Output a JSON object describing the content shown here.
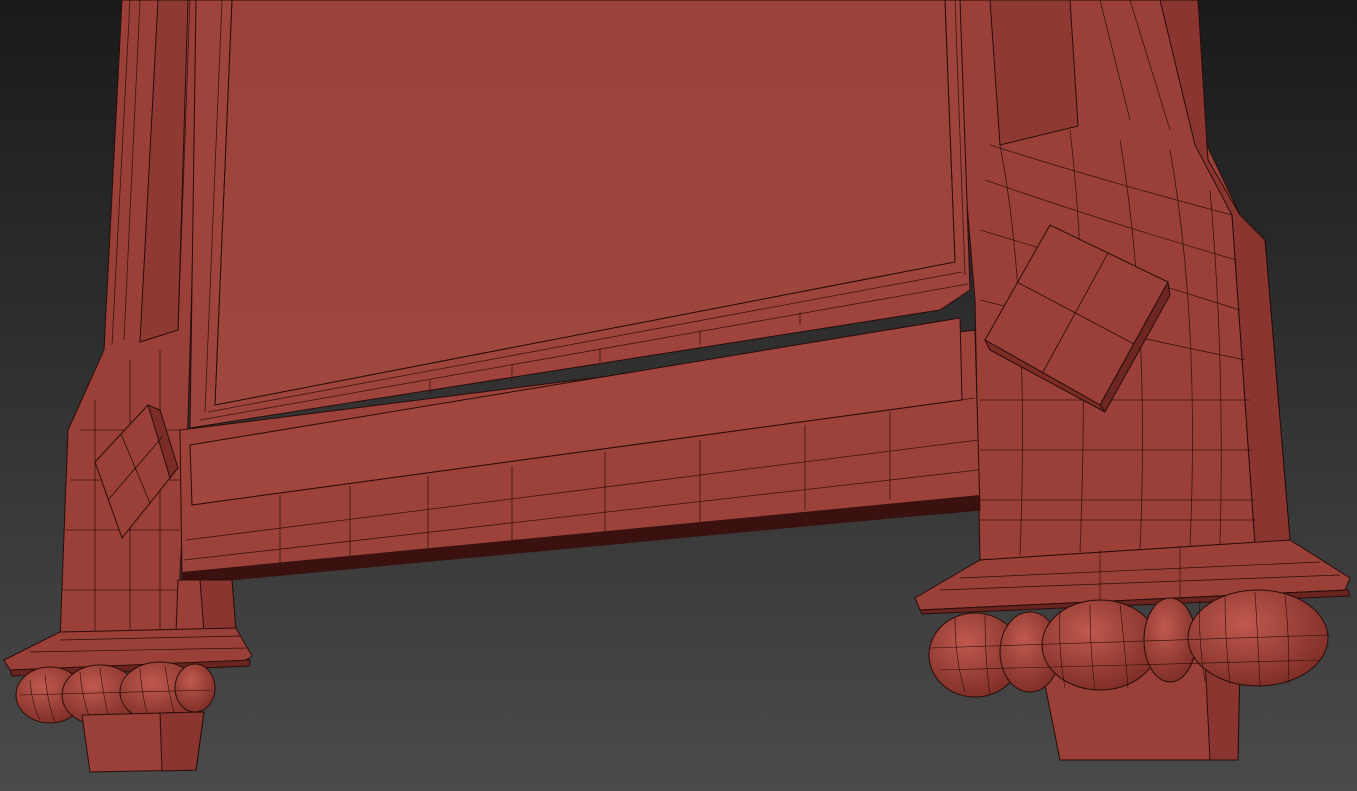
{
  "scene": {
    "background_color": "#2e2e2e",
    "model_color": "#9a4038",
    "model_shade_color": "#7a2c25",
    "model_highlight_color": "#b3554b",
    "wireframe_color": "#2a0d0a",
    "shadow_color": "#1e0806"
  }
}
